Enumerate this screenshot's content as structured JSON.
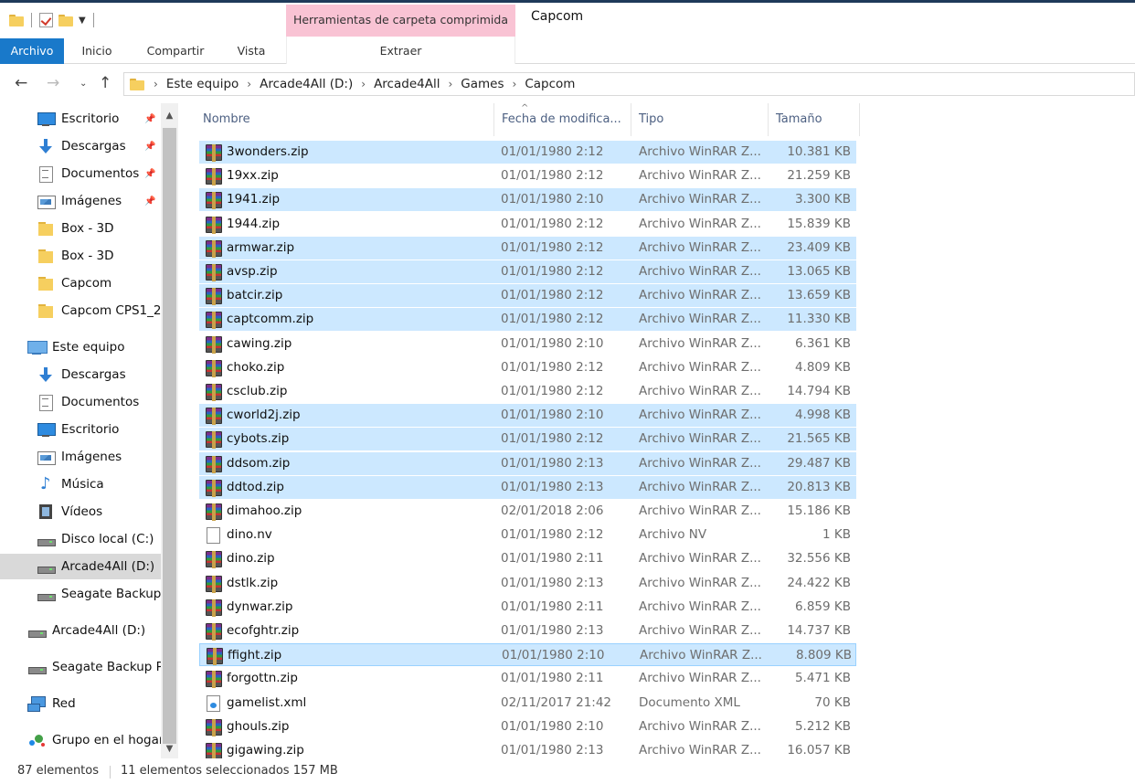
{
  "window": {
    "title": "Capcom",
    "context_group": "Herramientas de carpeta comprimida",
    "context_tab": "Extraer"
  },
  "ribbon": {
    "file_tab": "Archivo",
    "tabs": [
      "Inicio",
      "Compartir",
      "Vista"
    ]
  },
  "address": {
    "crumbs": [
      "Este equipo",
      "Arcade4All (D:)",
      "Arcade4All",
      "Games",
      "Capcom"
    ]
  },
  "sidebar": {
    "items": [
      {
        "label": "Escritorio",
        "icon": "desktop-icon",
        "pinned": true
      },
      {
        "label": "Descargas",
        "icon": "downloads-icon",
        "pinned": true
      },
      {
        "label": "Documentos",
        "icon": "documents-icon",
        "pinned": true
      },
      {
        "label": "Imágenes",
        "icon": "pictures-icon",
        "pinned": true
      },
      {
        "label": "Box - 3D",
        "icon": "folder-icon"
      },
      {
        "label": "Box - 3D",
        "icon": "folder-icon"
      },
      {
        "label": "Capcom",
        "icon": "folder-icon"
      },
      {
        "label": "Capcom CPS1_2",
        "icon": "folder-icon"
      },
      {
        "label": "Este equipo",
        "icon": "this-pc-icon"
      },
      {
        "label": "Descargas",
        "icon": "downloads-icon"
      },
      {
        "label": "Documentos",
        "icon": "documents-icon"
      },
      {
        "label": "Escritorio",
        "icon": "desktop-icon"
      },
      {
        "label": "Imágenes",
        "icon": "pictures-icon"
      },
      {
        "label": "Música",
        "icon": "music-icon"
      },
      {
        "label": "Vídeos",
        "icon": "videos-icon"
      },
      {
        "label": "Disco local (C:)",
        "icon": "drive-icon"
      },
      {
        "label": "Arcade4All (D:)",
        "icon": "drive-icon",
        "selected": true
      },
      {
        "label": "Seagate Backup",
        "icon": "drive-icon"
      },
      {
        "label": "Arcade4All (D:)",
        "icon": "drive-icon"
      },
      {
        "label": "Seagate Backup P",
        "icon": "drive-icon"
      },
      {
        "label": "Red",
        "icon": "network-icon"
      },
      {
        "label": "Grupo en el hogar",
        "icon": "homegroup-icon"
      }
    ]
  },
  "columns": {
    "name": "Nombre",
    "date": "Fecha de modifica...",
    "type": "Tipo",
    "size": "Tamaño"
  },
  "files": [
    {
      "name": "3wonders.zip",
      "date": "01/01/1980 2:12",
      "type": "Archivo WinRAR Z...",
      "size": "10.381 KB",
      "icon": "winrar-zip-icon",
      "selected": true
    },
    {
      "name": "19xx.zip",
      "date": "01/01/1980 2:12",
      "type": "Archivo WinRAR Z...",
      "size": "21.259 KB",
      "icon": "winrar-zip-icon",
      "selected": false
    },
    {
      "name": "1941.zip",
      "date": "01/01/1980 2:10",
      "type": "Archivo WinRAR Z...",
      "size": "3.300 KB",
      "icon": "winrar-zip-icon",
      "selected": true
    },
    {
      "name": "1944.zip",
      "date": "01/01/1980 2:12",
      "type": "Archivo WinRAR Z...",
      "size": "15.839 KB",
      "icon": "winrar-zip-icon",
      "selected": false
    },
    {
      "name": "armwar.zip",
      "date": "01/01/1980 2:12",
      "type": "Archivo WinRAR Z...",
      "size": "23.409 KB",
      "icon": "winrar-zip-icon",
      "selected": true
    },
    {
      "name": "avsp.zip",
      "date": "01/01/1980 2:12",
      "type": "Archivo WinRAR Z...",
      "size": "13.065 KB",
      "icon": "winrar-zip-icon",
      "selected": true
    },
    {
      "name": "batcir.zip",
      "date": "01/01/1980 2:12",
      "type": "Archivo WinRAR Z...",
      "size": "13.659 KB",
      "icon": "winrar-zip-icon",
      "selected": true
    },
    {
      "name": "captcomm.zip",
      "date": "01/01/1980 2:12",
      "type": "Archivo WinRAR Z...",
      "size": "11.330 KB",
      "icon": "winrar-zip-icon",
      "selected": true
    },
    {
      "name": "cawing.zip",
      "date": "01/01/1980 2:10",
      "type": "Archivo WinRAR Z...",
      "size": "6.361 KB",
      "icon": "winrar-zip-icon",
      "selected": false
    },
    {
      "name": "choko.zip",
      "date": "01/01/1980 2:12",
      "type": "Archivo WinRAR Z...",
      "size": "4.809 KB",
      "icon": "winrar-zip-icon",
      "selected": false
    },
    {
      "name": "csclub.zip",
      "date": "01/01/1980 2:12",
      "type": "Archivo WinRAR Z...",
      "size": "14.794 KB",
      "icon": "winrar-zip-icon",
      "selected": false
    },
    {
      "name": "cworld2j.zip",
      "date": "01/01/1980 2:10",
      "type": "Archivo WinRAR Z...",
      "size": "4.998 KB",
      "icon": "winrar-zip-icon",
      "selected": true
    },
    {
      "name": "cybots.zip",
      "date": "01/01/1980 2:12",
      "type": "Archivo WinRAR Z...",
      "size": "21.565 KB",
      "icon": "winrar-zip-icon",
      "selected": true
    },
    {
      "name": "ddsom.zip",
      "date": "01/01/1980 2:13",
      "type": "Archivo WinRAR Z...",
      "size": "29.487 KB",
      "icon": "winrar-zip-icon",
      "selected": true
    },
    {
      "name": "ddtod.zip",
      "date": "01/01/1980 2:13",
      "type": "Archivo WinRAR Z...",
      "size": "20.813 KB",
      "icon": "winrar-zip-icon",
      "selected": true
    },
    {
      "name": "dimahoo.zip",
      "date": "02/01/2018 2:06",
      "type": "Archivo WinRAR Z...",
      "size": "15.186 KB",
      "icon": "winrar-zip-icon",
      "selected": false
    },
    {
      "name": "dino.nv",
      "date": "01/01/1980 2:12",
      "type": "Archivo NV",
      "size": "1 KB",
      "icon": "blank-file-icon",
      "selected": false
    },
    {
      "name": "dino.zip",
      "date": "01/01/1980 2:11",
      "type": "Archivo WinRAR Z...",
      "size": "32.556 KB",
      "icon": "winrar-zip-icon",
      "selected": false
    },
    {
      "name": "dstlk.zip",
      "date": "01/01/1980 2:13",
      "type": "Archivo WinRAR Z...",
      "size": "24.422 KB",
      "icon": "winrar-zip-icon",
      "selected": false
    },
    {
      "name": "dynwar.zip",
      "date": "01/01/1980 2:11",
      "type": "Archivo WinRAR Z...",
      "size": "6.859 KB",
      "icon": "winrar-zip-icon",
      "selected": false
    },
    {
      "name": "ecofghtr.zip",
      "date": "01/01/1980 2:13",
      "type": "Archivo WinRAR Z...",
      "size": "14.737 KB",
      "icon": "winrar-zip-icon",
      "selected": false
    },
    {
      "name": "ffight.zip",
      "date": "01/01/1980 2:10",
      "type": "Archivo WinRAR Z...",
      "size": "8.809 KB",
      "icon": "winrar-zip-icon",
      "selected": true,
      "focused": true
    },
    {
      "name": "forgottn.zip",
      "date": "01/01/1980 2:11",
      "type": "Archivo WinRAR Z...",
      "size": "5.471 KB",
      "icon": "winrar-zip-icon",
      "selected": false
    },
    {
      "name": "gamelist.xml",
      "date": "02/11/2017 21:42",
      "type": "Documento XML",
      "size": "70 KB",
      "icon": "xml-file-icon",
      "selected": false
    },
    {
      "name": "ghouls.zip",
      "date": "01/01/1980 2:10",
      "type": "Archivo WinRAR Z...",
      "size": "5.212 KB",
      "icon": "winrar-zip-icon",
      "selected": false
    },
    {
      "name": "gigawing.zip",
      "date": "01/01/1980 2:13",
      "type": "Archivo WinRAR Z...",
      "size": "16.057 KB",
      "icon": "winrar-zip-icon",
      "selected": false
    }
  ],
  "status": {
    "count": "87 elementos",
    "selection": "11 elementos seleccionados  157 MB"
  },
  "colors": {
    "accent": "#1979ca",
    "selection": "#cce8ff",
    "context_tab": "#f9c3d4"
  }
}
